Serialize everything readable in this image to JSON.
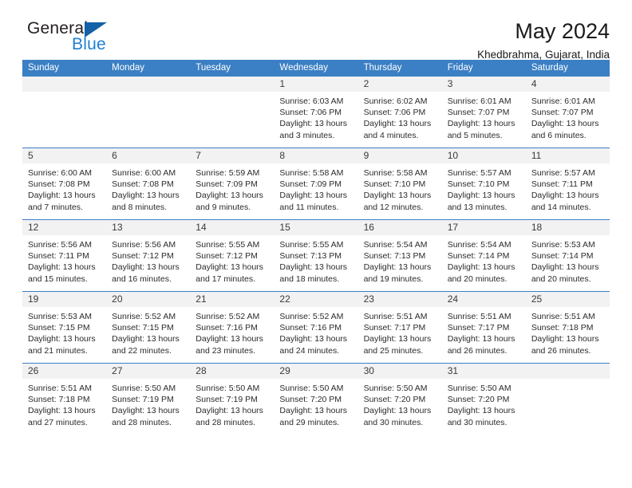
{
  "brand": {
    "name_top": "General",
    "name_bottom": "Blue",
    "triangle_color": "#1461a8",
    "blue_text_color": "#1e7fd4"
  },
  "header": {
    "month_title": "May 2024",
    "location": "Khedbrahma, Gujarat, India"
  },
  "theme": {
    "header_band": "#3b7fc4",
    "daynum_band": "#f2f2f2",
    "text": "#1a1a1a"
  },
  "weekdays": [
    "Sunday",
    "Monday",
    "Tuesday",
    "Wednesday",
    "Thursday",
    "Friday",
    "Saturday"
  ],
  "weeks": [
    [
      {
        "day": "",
        "lines": []
      },
      {
        "day": "",
        "lines": []
      },
      {
        "day": "",
        "lines": []
      },
      {
        "day": "1",
        "lines": [
          "Sunrise: 6:03 AM",
          "Sunset: 7:06 PM",
          "Daylight: 13 hours",
          "and 3 minutes."
        ]
      },
      {
        "day": "2",
        "lines": [
          "Sunrise: 6:02 AM",
          "Sunset: 7:06 PM",
          "Daylight: 13 hours",
          "and 4 minutes."
        ]
      },
      {
        "day": "3",
        "lines": [
          "Sunrise: 6:01 AM",
          "Sunset: 7:07 PM",
          "Daylight: 13 hours",
          "and 5 minutes."
        ]
      },
      {
        "day": "4",
        "lines": [
          "Sunrise: 6:01 AM",
          "Sunset: 7:07 PM",
          "Daylight: 13 hours",
          "and 6 minutes."
        ]
      }
    ],
    [
      {
        "day": "5",
        "lines": [
          "Sunrise: 6:00 AM",
          "Sunset: 7:08 PM",
          "Daylight: 13 hours",
          "and 7 minutes."
        ]
      },
      {
        "day": "6",
        "lines": [
          "Sunrise: 6:00 AM",
          "Sunset: 7:08 PM",
          "Daylight: 13 hours",
          "and 8 minutes."
        ]
      },
      {
        "day": "7",
        "lines": [
          "Sunrise: 5:59 AM",
          "Sunset: 7:09 PM",
          "Daylight: 13 hours",
          "and 9 minutes."
        ]
      },
      {
        "day": "8",
        "lines": [
          "Sunrise: 5:58 AM",
          "Sunset: 7:09 PM",
          "Daylight: 13 hours",
          "and 11 minutes."
        ]
      },
      {
        "day": "9",
        "lines": [
          "Sunrise: 5:58 AM",
          "Sunset: 7:10 PM",
          "Daylight: 13 hours",
          "and 12 minutes."
        ]
      },
      {
        "day": "10",
        "lines": [
          "Sunrise: 5:57 AM",
          "Sunset: 7:10 PM",
          "Daylight: 13 hours",
          "and 13 minutes."
        ]
      },
      {
        "day": "11",
        "lines": [
          "Sunrise: 5:57 AM",
          "Sunset: 7:11 PM",
          "Daylight: 13 hours",
          "and 14 minutes."
        ]
      }
    ],
    [
      {
        "day": "12",
        "lines": [
          "Sunrise: 5:56 AM",
          "Sunset: 7:11 PM",
          "Daylight: 13 hours",
          "and 15 minutes."
        ]
      },
      {
        "day": "13",
        "lines": [
          "Sunrise: 5:56 AM",
          "Sunset: 7:12 PM",
          "Daylight: 13 hours",
          "and 16 minutes."
        ]
      },
      {
        "day": "14",
        "lines": [
          "Sunrise: 5:55 AM",
          "Sunset: 7:12 PM",
          "Daylight: 13 hours",
          "and 17 minutes."
        ]
      },
      {
        "day": "15",
        "lines": [
          "Sunrise: 5:55 AM",
          "Sunset: 7:13 PM",
          "Daylight: 13 hours",
          "and 18 minutes."
        ]
      },
      {
        "day": "16",
        "lines": [
          "Sunrise: 5:54 AM",
          "Sunset: 7:13 PM",
          "Daylight: 13 hours",
          "and 19 minutes."
        ]
      },
      {
        "day": "17",
        "lines": [
          "Sunrise: 5:54 AM",
          "Sunset: 7:14 PM",
          "Daylight: 13 hours",
          "and 20 minutes."
        ]
      },
      {
        "day": "18",
        "lines": [
          "Sunrise: 5:53 AM",
          "Sunset: 7:14 PM",
          "Daylight: 13 hours",
          "and 20 minutes."
        ]
      }
    ],
    [
      {
        "day": "19",
        "lines": [
          "Sunrise: 5:53 AM",
          "Sunset: 7:15 PM",
          "Daylight: 13 hours",
          "and 21 minutes."
        ]
      },
      {
        "day": "20",
        "lines": [
          "Sunrise: 5:52 AM",
          "Sunset: 7:15 PM",
          "Daylight: 13 hours",
          "and 22 minutes."
        ]
      },
      {
        "day": "21",
        "lines": [
          "Sunrise: 5:52 AM",
          "Sunset: 7:16 PM",
          "Daylight: 13 hours",
          "and 23 minutes."
        ]
      },
      {
        "day": "22",
        "lines": [
          "Sunrise: 5:52 AM",
          "Sunset: 7:16 PM",
          "Daylight: 13 hours",
          "and 24 minutes."
        ]
      },
      {
        "day": "23",
        "lines": [
          "Sunrise: 5:51 AM",
          "Sunset: 7:17 PM",
          "Daylight: 13 hours",
          "and 25 minutes."
        ]
      },
      {
        "day": "24",
        "lines": [
          "Sunrise: 5:51 AM",
          "Sunset: 7:17 PM",
          "Daylight: 13 hours",
          "and 26 minutes."
        ]
      },
      {
        "day": "25",
        "lines": [
          "Sunrise: 5:51 AM",
          "Sunset: 7:18 PM",
          "Daylight: 13 hours",
          "and 26 minutes."
        ]
      }
    ],
    [
      {
        "day": "26",
        "lines": [
          "Sunrise: 5:51 AM",
          "Sunset: 7:18 PM",
          "Daylight: 13 hours",
          "and 27 minutes."
        ]
      },
      {
        "day": "27",
        "lines": [
          "Sunrise: 5:50 AM",
          "Sunset: 7:19 PM",
          "Daylight: 13 hours",
          "and 28 minutes."
        ]
      },
      {
        "day": "28",
        "lines": [
          "Sunrise: 5:50 AM",
          "Sunset: 7:19 PM",
          "Daylight: 13 hours",
          "and 28 minutes."
        ]
      },
      {
        "day": "29",
        "lines": [
          "Sunrise: 5:50 AM",
          "Sunset: 7:20 PM",
          "Daylight: 13 hours",
          "and 29 minutes."
        ]
      },
      {
        "day": "30",
        "lines": [
          "Sunrise: 5:50 AM",
          "Sunset: 7:20 PM",
          "Daylight: 13 hours",
          "and 30 minutes."
        ]
      },
      {
        "day": "31",
        "lines": [
          "Sunrise: 5:50 AM",
          "Sunset: 7:20 PM",
          "Daylight: 13 hours",
          "and 30 minutes."
        ]
      },
      {
        "day": "",
        "lines": []
      }
    ]
  ]
}
